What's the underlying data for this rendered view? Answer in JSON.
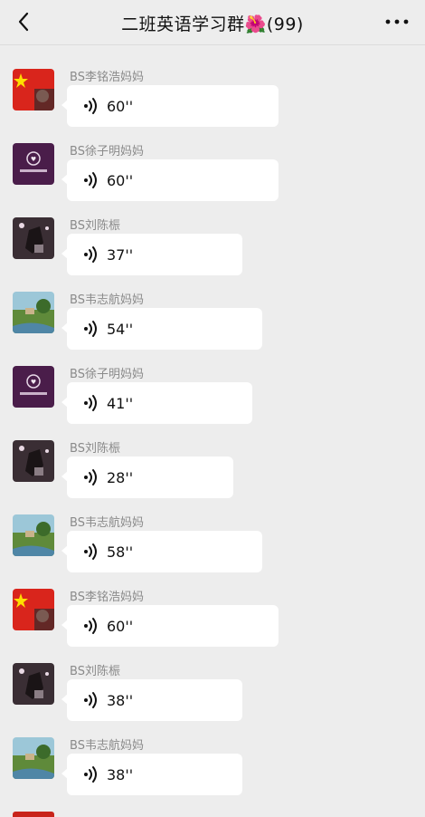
{
  "header": {
    "title": "二班英语学习群🌺(99)",
    "back_icon": "chevron-left-icon",
    "more_icon": "ellipsis-icon"
  },
  "messages": [
    {
      "sender": "BS李铭浩妈妈",
      "duration": "60''",
      "avatar": "flag"
    },
    {
      "sender": "BS徐子明妈妈",
      "duration": "60''",
      "avatar": "purple"
    },
    {
      "sender": "BS刘陈桭",
      "duration": "37''",
      "avatar": "dark"
    },
    {
      "sender": "BS韦志航妈妈",
      "duration": "54''",
      "avatar": "landscape"
    },
    {
      "sender": "BS徐子明妈妈",
      "duration": "41''",
      "avatar": "purple"
    },
    {
      "sender": "BS刘陈桭",
      "duration": "28''",
      "avatar": "dark"
    },
    {
      "sender": "BS韦志航妈妈",
      "duration": "58''",
      "avatar": "landscape"
    },
    {
      "sender": "BS李铭浩妈妈",
      "duration": "60''",
      "avatar": "flag"
    },
    {
      "sender": "BS刘陈桭",
      "duration": "38''",
      "avatar": "dark"
    },
    {
      "sender": "BS韦志航妈妈",
      "duration": "38''",
      "avatar": "landscape"
    }
  ],
  "colors": {
    "background": "#ededed",
    "bubble": "#ffffff",
    "sender_text": "#8a8a8a",
    "flag_red": "#d9251c",
    "flag_star": "#ffde00",
    "purple_avatar": "#4a1d4a"
  }
}
